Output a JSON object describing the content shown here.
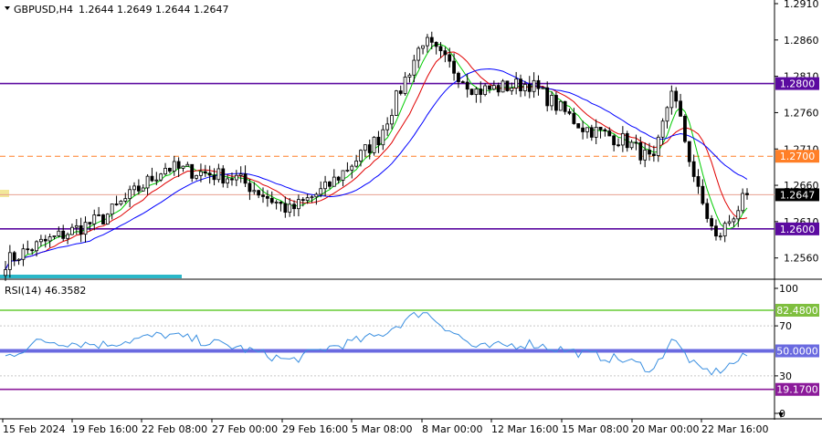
{
  "chart_data": [
    {
      "type": "candlestick",
      "symbol_timeframe": "GBPUSD,H4",
      "ohlc_text": "1.2644 1.2649 1.2644 1.2647",
      "ylim": [
        1.2532,
        1.2915
      ],
      "y_ticks": [
        "1.2910",
        "1.2860",
        "1.2810",
        "1.2760",
        "1.2710",
        "1.2660",
        "1.2610",
        "1.2560"
      ],
      "x_ticks": [
        "15 Feb 2024",
        "19 Feb 16:00",
        "22 Feb 08:00",
        "27 Feb 00:00",
        "29 Feb 16:00",
        "5 Mar 08:00",
        "8 Mar 00:00",
        "12 Mar 16:00",
        "15 Mar 08:00",
        "20 Mar 00:00",
        "22 Mar 16:00"
      ],
      "levels": [
        {
          "label": "1.2800",
          "value": 1.28,
          "color": "#5b0aa0",
          "style": "solid"
        },
        {
          "label": "1.2700",
          "value": 1.27,
          "color": "#ff7f27",
          "style": "dashed"
        },
        {
          "label": "1.2600",
          "value": 1.26,
          "color": "#5b0aa0",
          "style": "solid"
        }
      ],
      "current_price": {
        "label": "1.2647",
        "value": 1.2647,
        "color": "#e8a090"
      },
      "key_points": [
        {
          "i": 0,
          "price": 1.2555
        },
        {
          "i": 8,
          "price": 1.258
        },
        {
          "i": 22,
          "price": 1.2615
        },
        {
          "i": 36,
          "price": 1.2685
        },
        {
          "i": 52,
          "price": 1.267
        },
        {
          "i": 64,
          "price": 1.2625
        },
        {
          "i": 72,
          "price": 1.2655
        },
        {
          "i": 84,
          "price": 1.2725
        },
        {
          "i": 94,
          "price": 1.286
        },
        {
          "i": 106,
          "price": 1.279
        },
        {
          "i": 118,
          "price": 1.28
        },
        {
          "i": 130,
          "price": 1.274
        },
        {
          "i": 140,
          "price": 1.272
        },
        {
          "i": 146,
          "price": 1.269
        },
        {
          "i": 150,
          "price": 1.2795
        },
        {
          "i": 156,
          "price": 1.265
        },
        {
          "i": 160,
          "price": 1.2585
        },
        {
          "i": 167,
          "price": 1.2647
        }
      ],
      "moving_averages": [
        {
          "period": 5,
          "color": "#00cc00"
        },
        {
          "period": 10,
          "color": "#e00000"
        },
        {
          "period": 20,
          "color": "#0000ff"
        }
      ]
    },
    {
      "type": "line",
      "indicator": "RSI(14) 46.3582",
      "ylim": [
        0,
        100
      ],
      "y_ticks": [
        "100",
        "70",
        "30",
        "0"
      ],
      "levels": [
        {
          "label": "82.4800",
          "value": 82.48,
          "color": "#66cc33"
        },
        {
          "label": "50.0000",
          "value": 50,
          "color": "#6a6ae0"
        },
        {
          "label": "19.1700",
          "value": 19.17,
          "color": "#8b1a9a"
        }
      ],
      "key_points": [
        {
          "i": 0,
          "value": 45
        },
        {
          "i": 8,
          "value": 58
        },
        {
          "i": 22,
          "value": 55
        },
        {
          "i": 36,
          "value": 63
        },
        {
          "i": 52,
          "value": 53
        },
        {
          "i": 64,
          "value": 42
        },
        {
          "i": 72,
          "value": 52
        },
        {
          "i": 84,
          "value": 62
        },
        {
          "i": 94,
          "value": 82
        },
        {
          "i": 106,
          "value": 52
        },
        {
          "i": 118,
          "value": 56
        },
        {
          "i": 130,
          "value": 48
        },
        {
          "i": 140,
          "value": 42
        },
        {
          "i": 146,
          "value": 35
        },
        {
          "i": 150,
          "value": 60
        },
        {
          "i": 156,
          "value": 35
        },
        {
          "i": 160,
          "value": 33
        },
        {
          "i": 167,
          "value": 46
        }
      ]
    }
  ]
}
